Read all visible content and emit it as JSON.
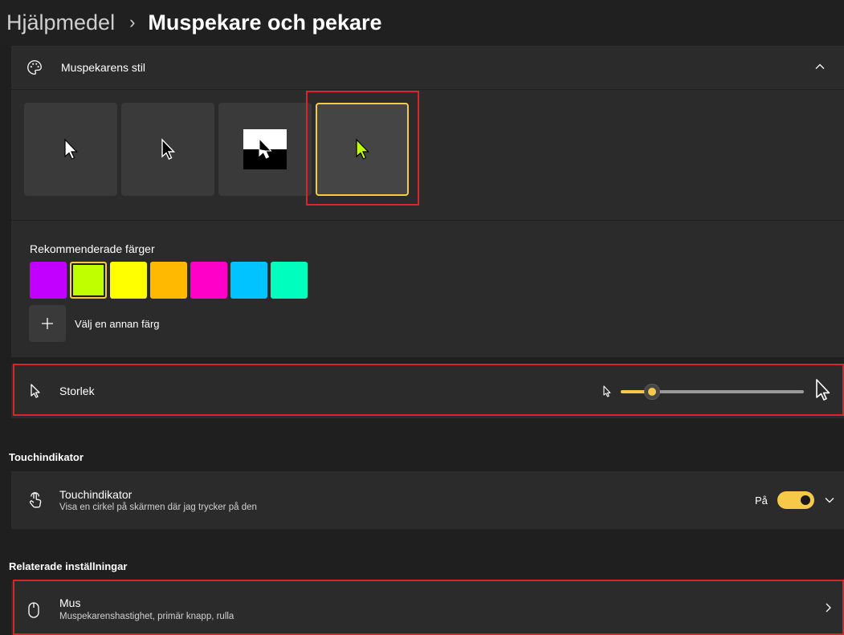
{
  "breadcrumb": {
    "parent": "Hjälpmedel",
    "separator": "›",
    "current": "Muspekare och pekare"
  },
  "pointer_style": {
    "title": "Muspekarens stil",
    "icon": "palette-icon",
    "styles": [
      {
        "name": "Vit",
        "icon": "white-cursor-icon"
      },
      {
        "name": "Svart",
        "icon": "black-cursor-icon"
      },
      {
        "name": "Inverterad",
        "icon": "inverted-cursor-icon"
      },
      {
        "name": "Anpassad",
        "icon": "custom-color-cursor-icon",
        "selected": true
      }
    ]
  },
  "colors": {
    "title": "Rekommenderade färger",
    "swatches": [
      "#c100ff",
      "#bfff00",
      "#ffff00",
      "#ffb900",
      "#ff00c8",
      "#00c3ff",
      "#00ffbf"
    ],
    "selected_index": 1,
    "other_label": "Välj en annan färg"
  },
  "size": {
    "label": "Storlek",
    "icon": "cursor-icon",
    "slider_fraction": 0.17
  },
  "touch_section": {
    "heading": "Touchindikator",
    "title": "Touchindikator",
    "subtitle": "Visa en cirkel på skärmen där jag trycker på den",
    "icon": "touch-icon",
    "toggle_label": "På",
    "toggle_on": true
  },
  "related": {
    "heading": "Relaterade inställningar",
    "title": "Mus",
    "subtitle": "Muspekarenshastighet, primär knapp, rulla",
    "icon": "mouse-icon"
  },
  "colors_theme": {
    "accent": "#f7c948",
    "highlight": "#d9232e",
    "card": "#2b2b2b",
    "background": "#1f1f1f"
  }
}
